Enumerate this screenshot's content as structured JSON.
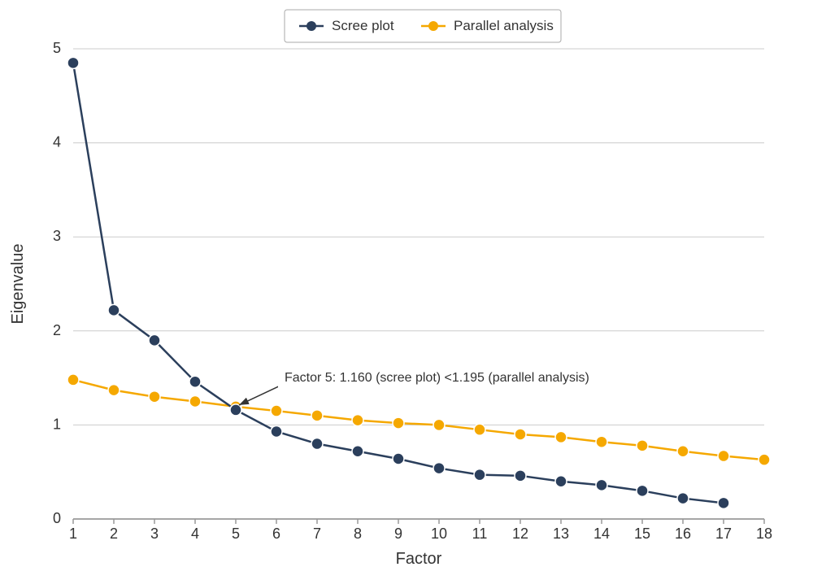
{
  "chart": {
    "title": "",
    "legend": {
      "scree_label": "Scree plot",
      "parallel_label": "Parallel analysis"
    },
    "x_axis_label": "Factor",
    "y_axis_label": "Eigenvalue",
    "annotation": "Factor 5: 1.160 (scree plot) <1.195 (parallel analysis)",
    "colors": {
      "scree": "#2b3f5c",
      "parallel": "#f5a800",
      "grid": "#cccccc",
      "axis": "#333333",
      "text": "#333333"
    },
    "y_ticks": [
      0,
      1,
      2,
      3,
      4,
      5
    ],
    "x_ticks": [
      1,
      2,
      3,
      4,
      5,
      6,
      7,
      8,
      9,
      10,
      11,
      12,
      13,
      14,
      15,
      16,
      17,
      18
    ],
    "scree_data": [
      4.85,
      2.22,
      1.9,
      1.46,
      1.16,
      0.93,
      0.8,
      0.72,
      0.64,
      0.54,
      0.47,
      0.46,
      0.4,
      0.36,
      0.3,
      0.22,
      0.17
    ],
    "parallel_data": [
      1.48,
      1.37,
      1.3,
      1.25,
      1.195,
      1.15,
      1.1,
      1.05,
      1.02,
      1.0,
      0.95,
      0.9,
      0.87,
      0.82,
      0.78,
      0.72,
      0.67,
      0.63
    ]
  }
}
